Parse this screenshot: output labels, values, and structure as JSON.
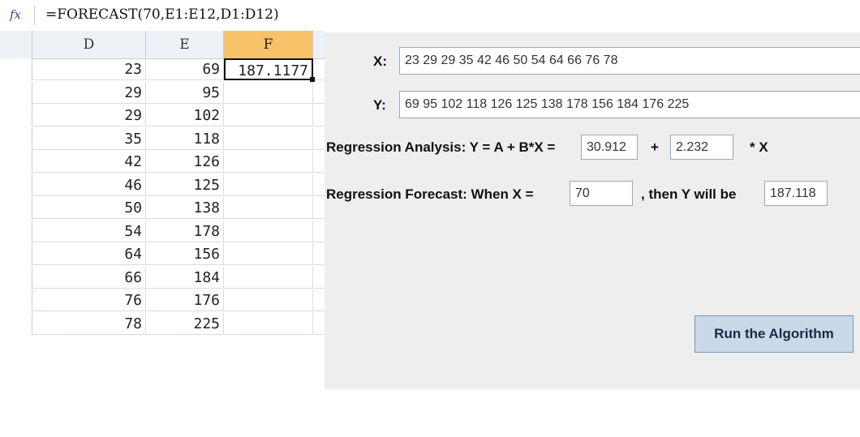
{
  "formula_bar": {
    "icon": "fx",
    "formula": "=FORECAST(70,E1:E12,D1:D12)"
  },
  "sheet": {
    "columns": [
      "D",
      "E",
      "F"
    ],
    "active_column": "F",
    "selected_cell_value": "187.1177",
    "rows": [
      {
        "d": "23",
        "e": "69"
      },
      {
        "d": "29",
        "e": "95"
      },
      {
        "d": "29",
        "e": "102"
      },
      {
        "d": "35",
        "e": "118"
      },
      {
        "d": "42",
        "e": "126"
      },
      {
        "d": "46",
        "e": "125"
      },
      {
        "d": "50",
        "e": "138"
      },
      {
        "d": "54",
        "e": "178"
      },
      {
        "d": "64",
        "e": "156"
      },
      {
        "d": "66",
        "e": "184"
      },
      {
        "d": "76",
        "e": "176"
      },
      {
        "d": "78",
        "e": "225"
      }
    ]
  },
  "app": {
    "x_label": "X:",
    "x_value": "23 29 29  35  42  46  50  54  64  66  76  78",
    "y_label": "Y:",
    "y_value": "69 95 102 118 126 125 138 178 156 184 176 225",
    "regression_label": "Regression Analysis: Y = A + B*X =",
    "a_value": "30.912",
    "plus": "+",
    "b_value": "2.232",
    "times_x": "* X",
    "forecast_label": "Regression Forecast:  When X =",
    "forecast_x": "70",
    "then_label": ",  then  Y will be",
    "forecast_y": "187.118",
    "run_button": "Run the Algorithm"
  }
}
